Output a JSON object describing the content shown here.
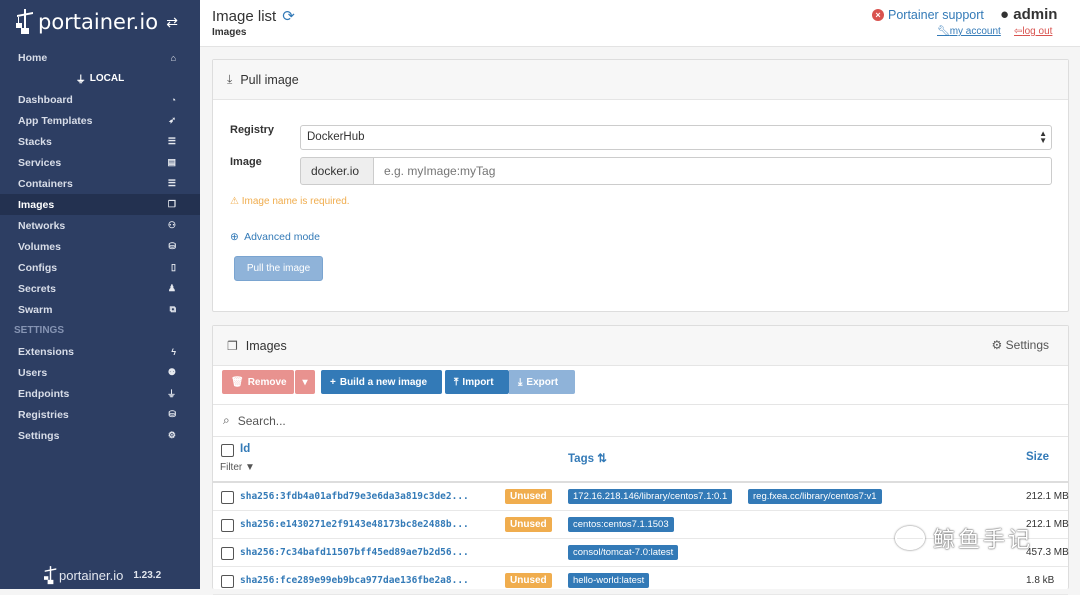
{
  "sidebar": {
    "brand": "portainer.io",
    "items": [
      {
        "label": "Home",
        "icon": "home-icon",
        "glyph": "⌂"
      },
      {
        "label": "LOCAL",
        "icon": "plug-icon",
        "glyph": "⏚"
      },
      {
        "label": "Dashboard",
        "icon": "tachometer-icon",
        "glyph": "◔"
      },
      {
        "label": "App Templates",
        "icon": "rocket-icon",
        "glyph": "➶"
      },
      {
        "label": "Stacks",
        "icon": "list-icon",
        "glyph": "☰"
      },
      {
        "label": "Services",
        "icon": "list-alt-icon",
        "glyph": "▤"
      },
      {
        "label": "Containers",
        "icon": "server-icon",
        "glyph": "☰"
      },
      {
        "label": "Images",
        "icon": "clone-icon",
        "glyph": "❐"
      },
      {
        "label": "Networks",
        "icon": "sitemap-icon",
        "glyph": "⚇"
      },
      {
        "label": "Volumes",
        "icon": "cubes-icon",
        "glyph": "⛁"
      },
      {
        "label": "Configs",
        "icon": "file-icon",
        "glyph": "▯"
      },
      {
        "label": "Secrets",
        "icon": "user-secret-icon",
        "glyph": "♟"
      },
      {
        "label": "Swarm",
        "icon": "object-group-icon",
        "glyph": "⧉"
      },
      {
        "label": "SETTINGS"
      },
      {
        "label": "Extensions",
        "icon": "bolt-icon",
        "glyph": "ϟ"
      },
      {
        "label": "Users",
        "icon": "users-icon",
        "glyph": "⚉"
      },
      {
        "label": "Endpoints",
        "icon": "plug-icon",
        "glyph": "⏚"
      },
      {
        "label": "Registries",
        "icon": "database-icon",
        "glyph": "⛁"
      },
      {
        "label": "Settings",
        "icon": "cogs-icon",
        "glyph": "⚙"
      }
    ],
    "footer_brand": "portainer.io",
    "version": "1.23.2"
  },
  "header": {
    "title": "Image list",
    "breadcrumb": "Images",
    "support": "Portainer support",
    "user": "admin",
    "my_account": "my account",
    "log_out": "log out"
  },
  "pull": {
    "title": "Pull image",
    "registry_label": "Registry",
    "registry_value": "DockerHub",
    "image_label": "Image",
    "image_prefix": "docker.io",
    "image_placeholder": "e.g. myImage:myTag",
    "warning": "Image name is required.",
    "advanced": "Advanced mode",
    "button": "Pull the image"
  },
  "images": {
    "title": "Images",
    "settings": "Settings",
    "remove": "Remove",
    "build": "Build a new image",
    "import": "Import",
    "export": "Export",
    "search_placeholder": "Search...",
    "col_id": "Id",
    "filter": "Filter",
    "col_tags": "Tags",
    "col_size": "Size",
    "rows": [
      {
        "id": "sha256:3fdb4a01afbd79e3e6da3a819c3de2...",
        "unused": "Unused",
        "tags": [
          "172.16.218.146/library/centos7.1:0.1",
          "reg.fxea.cc/library/centos7:v1"
        ],
        "size": "212.1 MB"
      },
      {
        "id": "sha256:e1430271e2f9143e48173bc8e2488b...",
        "unused": "Unused",
        "tags": [
          "centos:centos7.1.1503"
        ],
        "size": "212.1 MB"
      },
      {
        "id": "sha256:7c34bafd11507bff45ed89ae7b2d56...",
        "unused": "",
        "tags": [
          "consol/tomcat-7.0:latest"
        ],
        "size": "457.3 MB"
      },
      {
        "id": "sha256:fce289e99eb9bca977dae136fbe2a8...",
        "unused": "Unused",
        "tags": [
          "hello-world:latest"
        ],
        "size": "1.8 kB"
      }
    ]
  },
  "watermark": "鲸鱼手记"
}
